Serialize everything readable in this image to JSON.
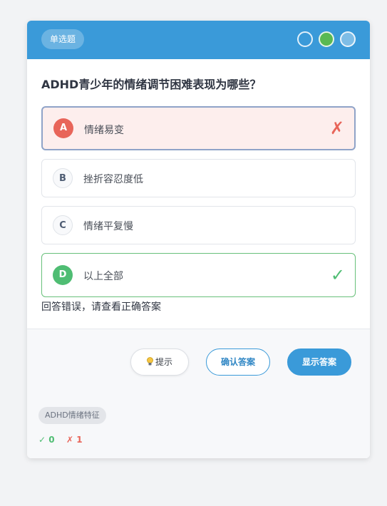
{
  "header": {
    "question_type": "单选题",
    "progress_dots": [
      "unanswered",
      "current",
      "unanswered"
    ]
  },
  "question": {
    "text": "ADHD青少年的情绪调节困难表现为哪些？"
  },
  "options": [
    {
      "letter": "A",
      "text": "情绪易变",
      "state": "wrong",
      "mark": "✗"
    },
    {
      "letter": "B",
      "text": "挫折容忍度低",
      "state": "normal",
      "mark": ""
    },
    {
      "letter": "C",
      "text": "情绪平复慢",
      "state": "normal",
      "mark": ""
    },
    {
      "letter": "D",
      "text": "以上全部",
      "state": "correct",
      "mark": "✓"
    }
  ],
  "feedback": "回答错误，请查看正确答案",
  "actions": {
    "hint_label": "提示",
    "confirm_label": "确认答案",
    "show_label": "显示答案"
  },
  "footer": {
    "tag": "ADHD情绪特征",
    "correct_icon": "✓",
    "correct_count": "0",
    "wrong_icon": "✗",
    "wrong_count": "1"
  },
  "colors": {
    "accent": "#3a9ad9",
    "correct": "#4fbd73",
    "wrong": "#e8655a"
  }
}
